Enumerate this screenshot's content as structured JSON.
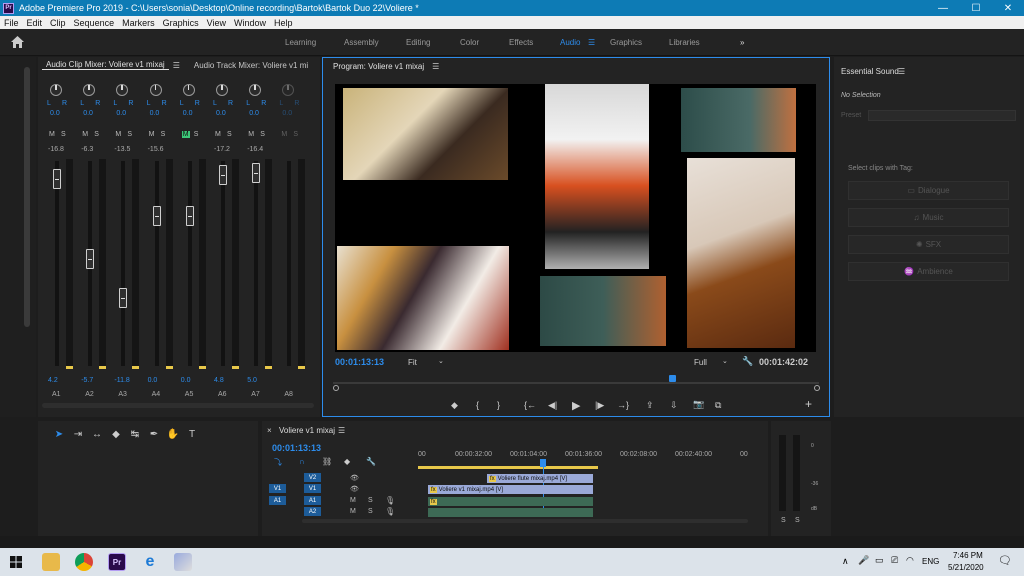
{
  "window": {
    "title": "Adobe Premiere Pro 2019 - C:\\Users\\sonia\\Desktop\\Online recording\\Bartok\\Bartok Duo 22\\Voliere *",
    "logo_text": "Pr",
    "min": "—",
    "max": "☐",
    "close": "✕"
  },
  "menu": [
    "File",
    "Edit",
    "Clip",
    "Sequence",
    "Markers",
    "Graphics",
    "View",
    "Window",
    "Help"
  ],
  "workspaces": [
    "Learning",
    "Assembly",
    "Editing",
    "Color",
    "Effects",
    "Audio",
    "Graphics",
    "Libraries"
  ],
  "workspace_active": "Audio",
  "workspace_menu_icon": "☰",
  "workspace_more": "»",
  "mixer": {
    "tab_clip": "Audio Clip Mixer: Voliere v1 mixaj",
    "tab_track": "Audio Track Mixer: Voliere v1 mi",
    "menu_icon": "☰",
    "more": "»",
    "l": "L",
    "r": "R",
    "zero": "0.0",
    "m": "M",
    "s": "S",
    "channels": [
      {
        "label": "A1",
        "db": "-16.8",
        "value": "4.2",
        "level": 0.96,
        "active": true
      },
      {
        "label": "A2",
        "db": "-6.3",
        "value": "-5.7",
        "level": 0.55,
        "active": true
      },
      {
        "label": "A3",
        "db": "-13.5",
        "value": "-11.8",
        "level": 0.35,
        "active": true
      },
      {
        "label": "A4",
        "db": "-15.6",
        "value": "0.0",
        "level": 0.77,
        "active": true
      },
      {
        "label": "A5",
        "db": "",
        "value": "0.0",
        "level": 0.77,
        "active": true,
        "muted": true
      },
      {
        "label": "A6",
        "db": "-17.2",
        "value": "4.8",
        "level": 0.98,
        "active": true
      },
      {
        "label": "A7",
        "db": "-16.4",
        "value": "5.0",
        "level": 0.99,
        "active": true
      },
      {
        "label": "A8",
        "db": "",
        "value": "",
        "level": -1,
        "active": false
      }
    ]
  },
  "program": {
    "tab": "Program: Voliere v1 mixaj",
    "menu_icon": "☰",
    "timecode": "00:01:13:13",
    "fit": "Fit",
    "quality": "Full",
    "duration": "00:01:42:02",
    "controls": {
      "marker": "◆",
      "in": "{",
      "out": "}",
      "goto_in": "{←",
      "step_back": "◀|",
      "play": "▶",
      "step_fwd": "|▶",
      "goto_out": "→}",
      "lift": "⇪",
      "extract": "⇩",
      "export": "📷",
      "compare": "⧉",
      "add": "+"
    },
    "playhead": 0.7
  },
  "essential_sound": {
    "title": "Essential Sound",
    "menu_icon": "☰",
    "no_selection": "No Selection",
    "preset": "Preset",
    "tag_label": "Select clips with Tag:",
    "buttons": [
      "Dialogue",
      "Music",
      "SFX",
      "Ambience"
    ]
  },
  "tools": {
    "icons": [
      "selection-tool",
      "track-select-tool",
      "ripple-tool",
      "razor-tool",
      "slip-tool",
      "pen-tool",
      "hand-tool",
      "type-tool"
    ],
    "glyphs": [
      "➤",
      "⇥",
      "↔",
      "◆",
      "↹",
      "✒",
      "✋",
      "T"
    ]
  },
  "timeline": {
    "close": "×",
    "tab": "Voliere v1 mixaj",
    "menu_icon": "☰",
    "timecode": "00:01:13:13",
    "ruler": [
      "00",
      "00:00:32:00",
      "00:01:04:00",
      "00:01:36:00",
      "00:02:08:00",
      "00:02:40:00",
      "00"
    ],
    "tracks": {
      "v2": "V2",
      "v1_src": "V1",
      "v1": "V1",
      "a1_src": "A1",
      "a1": "A1",
      "a2": "A2",
      "m": "M",
      "s": "S"
    },
    "clips": {
      "v2": "Voliere flute mixaj.mp4 [V]",
      "v1": "Voliere v1 mixaj.mp4 [V]",
      "fx": "fx"
    },
    "meter_labels": [
      "0",
      "-36",
      "dB"
    ],
    "meter_s": "S"
  },
  "taskbar": {
    "time": "7:46 PM",
    "date": "5/21/2020",
    "lang": "ENG"
  }
}
